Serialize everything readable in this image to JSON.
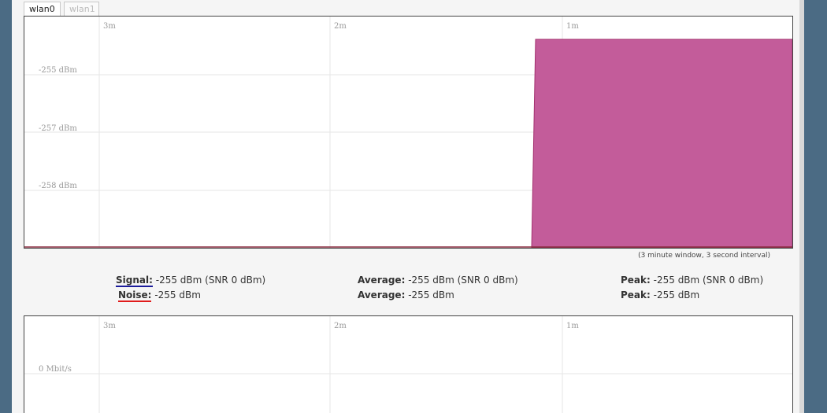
{
  "tabs": [
    {
      "label": "wlan0",
      "active": true
    },
    {
      "label": "wlan1",
      "active": false
    }
  ],
  "signal_chart": {
    "time_labels": [
      "3m",
      "2m",
      "1m"
    ],
    "y_labels": [
      "-255 dBm",
      "-257 dBm",
      "-258 dBm"
    ],
    "fill_color": "#c35c9a",
    "fill_start_fraction": 0.66,
    "fill_level_fraction": 0.1
  },
  "window_note": "(3 minute window, 3 second interval)",
  "stats": {
    "signal": {
      "label": "Signal:",
      "value": "-255 dBm (SNR 0 dBm)",
      "average_label": "Average:",
      "average_value": "-255 dBm (SNR 0 dBm)",
      "peak_label": "Peak:",
      "peak_value": "-255 dBm (SNR 0 dBm)",
      "color": "#1b1b9b"
    },
    "noise": {
      "label": "Noise:",
      "value": "-255 dBm",
      "average_label": "Average:",
      "average_value": "-255 dBm",
      "peak_label": "Peak:",
      "peak_value": "-255 dBm",
      "color": "#e01b1b"
    }
  },
  "traffic_chart": {
    "time_labels": [
      "3m",
      "2m",
      "1m"
    ],
    "y_labels": [
      "0 Mbit/s"
    ]
  }
}
